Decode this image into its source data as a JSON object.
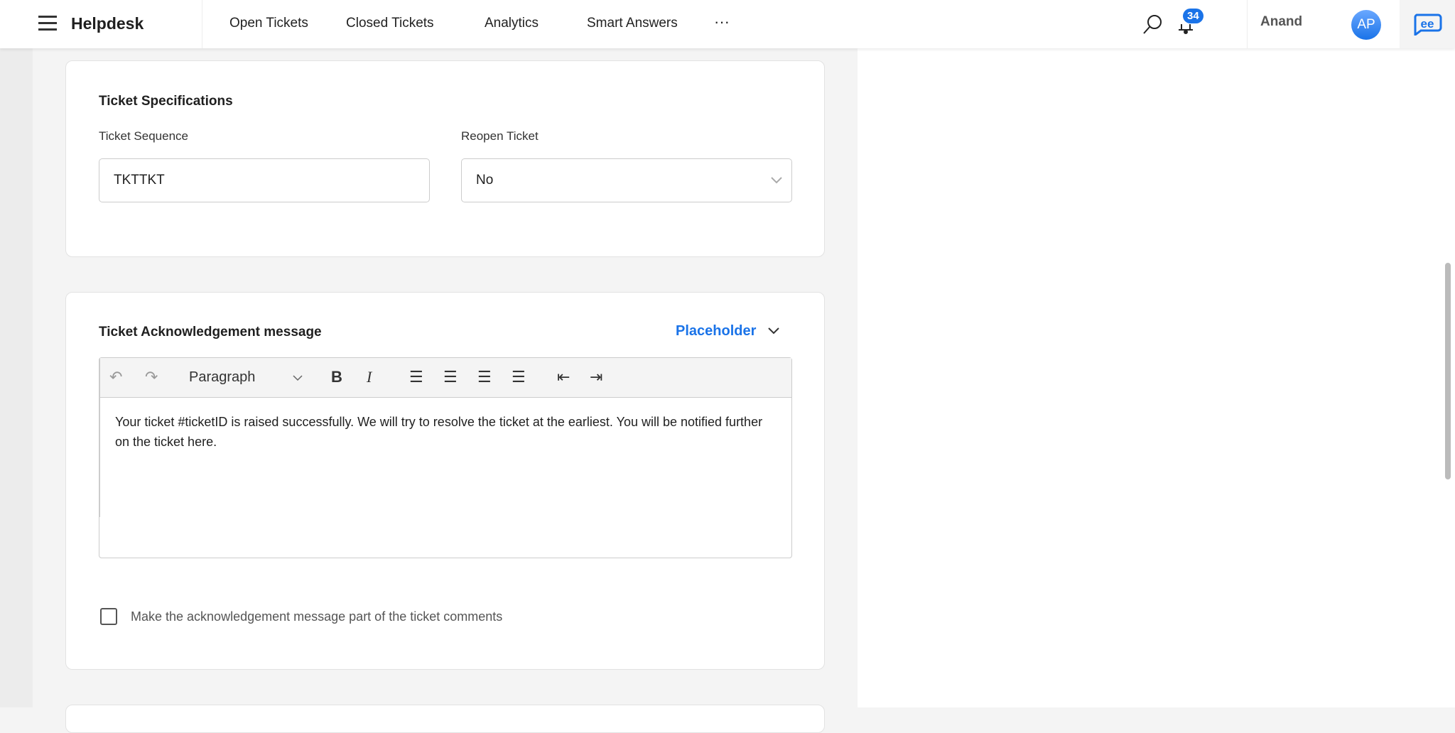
{
  "nav": {
    "brand": "Helpdesk",
    "links": [
      "Open Tickets",
      "Closed Tickets",
      "Analytics",
      "Smart Answers"
    ],
    "more": "···",
    "notifications": "34",
    "user": "Anand",
    "avatar": "AP"
  },
  "specs": {
    "title": "Ticket Specifications",
    "seq_label": "Ticket Sequence",
    "seq_value": "TKTTKT",
    "reopen_label": "Reopen Ticket",
    "reopen_value": "No"
  },
  "ack": {
    "title": "Ticket Acknowledgement message",
    "placeholder": "Placeholder",
    "format": "Paragraph",
    "bold": "B",
    "italic": "I",
    "body": "Your ticket #ticketID is raised successfully. We will try to resolve the ticket at the earliest. You will be notified further on the ticket here.",
    "checkbox_label": "Make the acknowledgement message part of the ticket comments"
  }
}
